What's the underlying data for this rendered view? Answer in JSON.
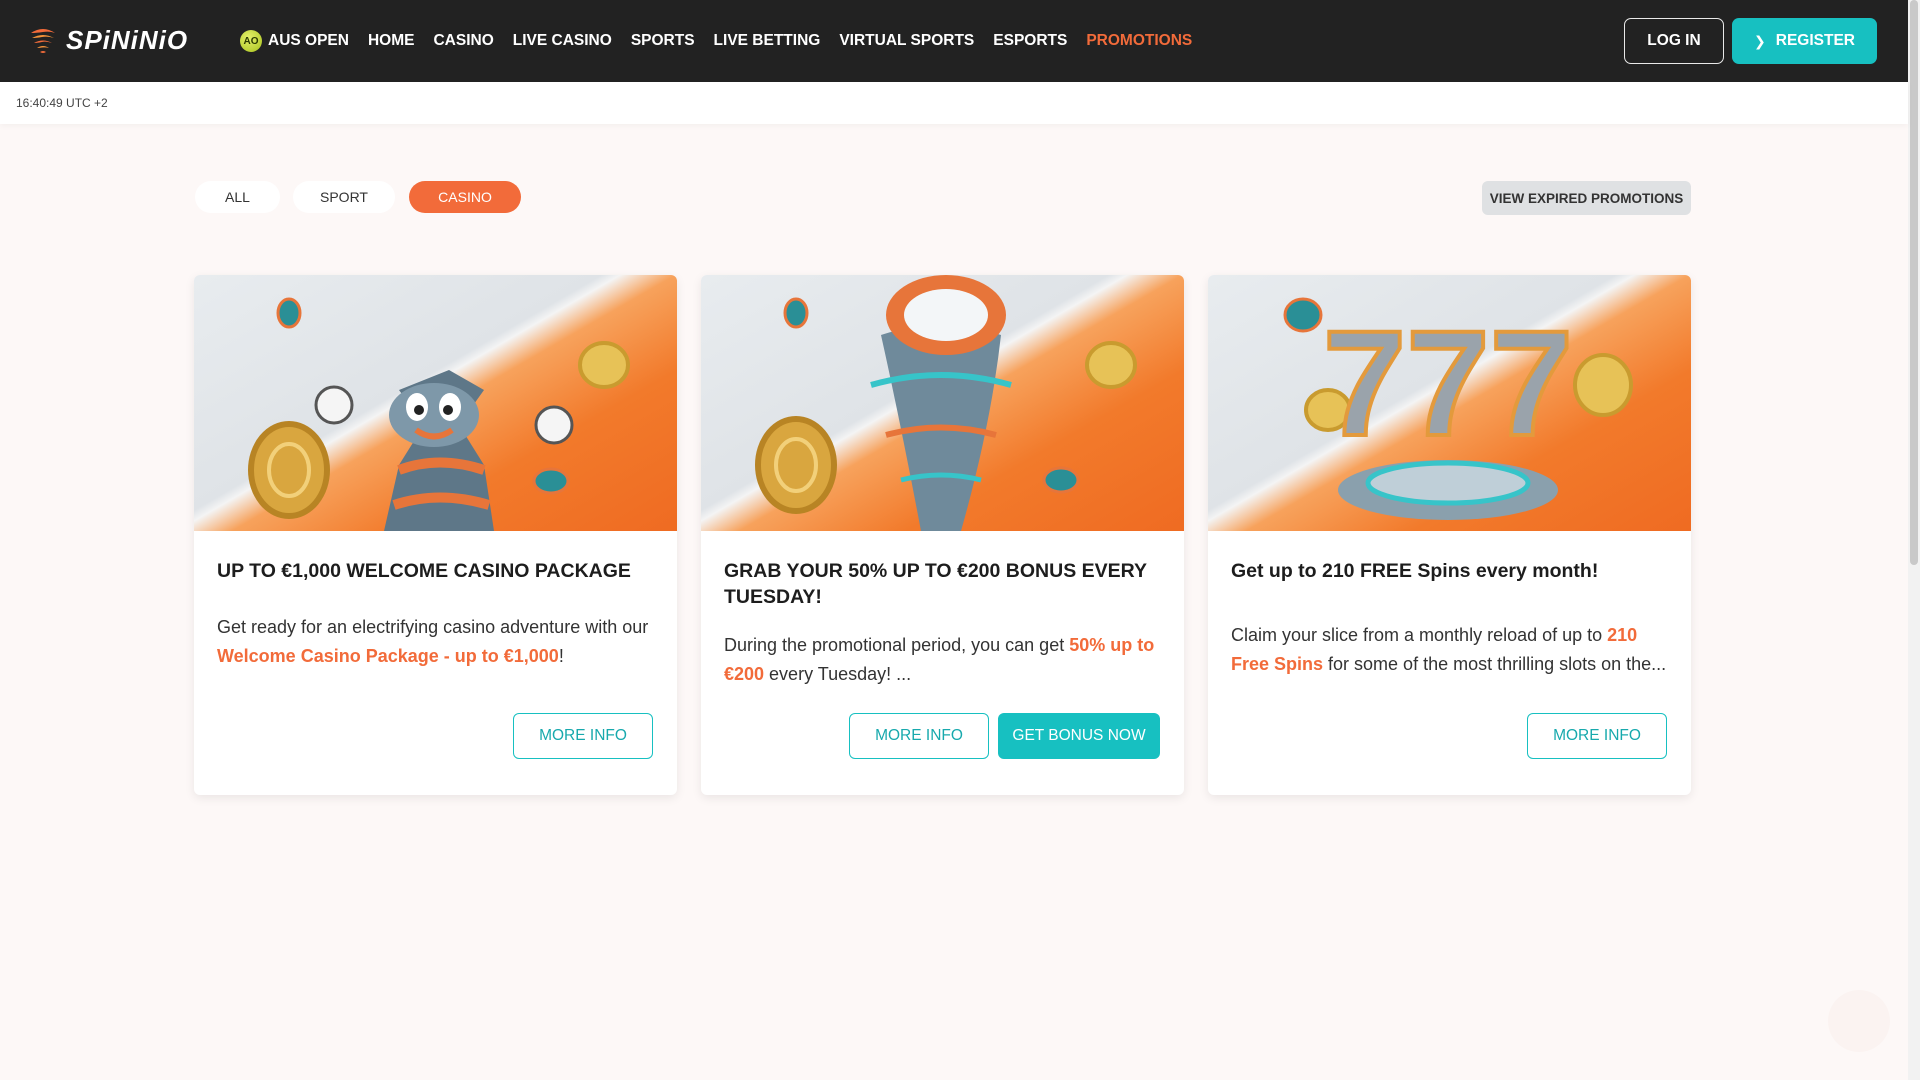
{
  "brand": {
    "name": "SPiNiNiO"
  },
  "nav": {
    "items": [
      {
        "label": "AUS OPEN",
        "badge": "AO"
      },
      {
        "label": "HOME"
      },
      {
        "label": "CASINO"
      },
      {
        "label": "LIVE CASINO"
      },
      {
        "label": "SPORTS"
      },
      {
        "label": "LIVE BETTING"
      },
      {
        "label": "VIRTUAL SPORTS"
      },
      {
        "label": "ESPORTS"
      },
      {
        "label": "PROMOTIONS",
        "active": true
      }
    ],
    "login": "LOG IN",
    "register": "REGISTER"
  },
  "timebar": {
    "time": "16:40:49 UTC +2"
  },
  "filters": {
    "items": [
      {
        "label": "ALL"
      },
      {
        "label": "SPORT"
      },
      {
        "label": "CASINO",
        "active": true
      }
    ],
    "expired": "VIEW EXPIRED PROMOTIONS"
  },
  "cards": [
    {
      "title": "UP TO €1,000 WELCOME CASINO PACKAGE",
      "text_before": "Get ready for an electrifying casino adventure with our ",
      "highlight": "Welcome Casino Package - up to €1,000",
      "text_after": "!",
      "more": "MORE INFO"
    },
    {
      "title": "GRAB YOUR 50% UP TO €200 BONUS EVERY TUESDAY!",
      "text_before": "During the promotional period, you can get ",
      "highlight": "50% up to €200",
      "text_after": " every Tuesday! ...",
      "more": "MORE INFO",
      "cta": "GET BONUS NOW"
    },
    {
      "title": "Get up to 210 FREE Spins every month!",
      "text_before": "Claim your slice from a monthly reload of up to ",
      "highlight": "210 Free Spins",
      "text_after": " for some of the most thrilling slots on the...",
      "more": "MORE INFO"
    }
  ],
  "colors": {
    "accent": "#f26b3a",
    "teal": "#17c0c1",
    "header": "#222222"
  }
}
